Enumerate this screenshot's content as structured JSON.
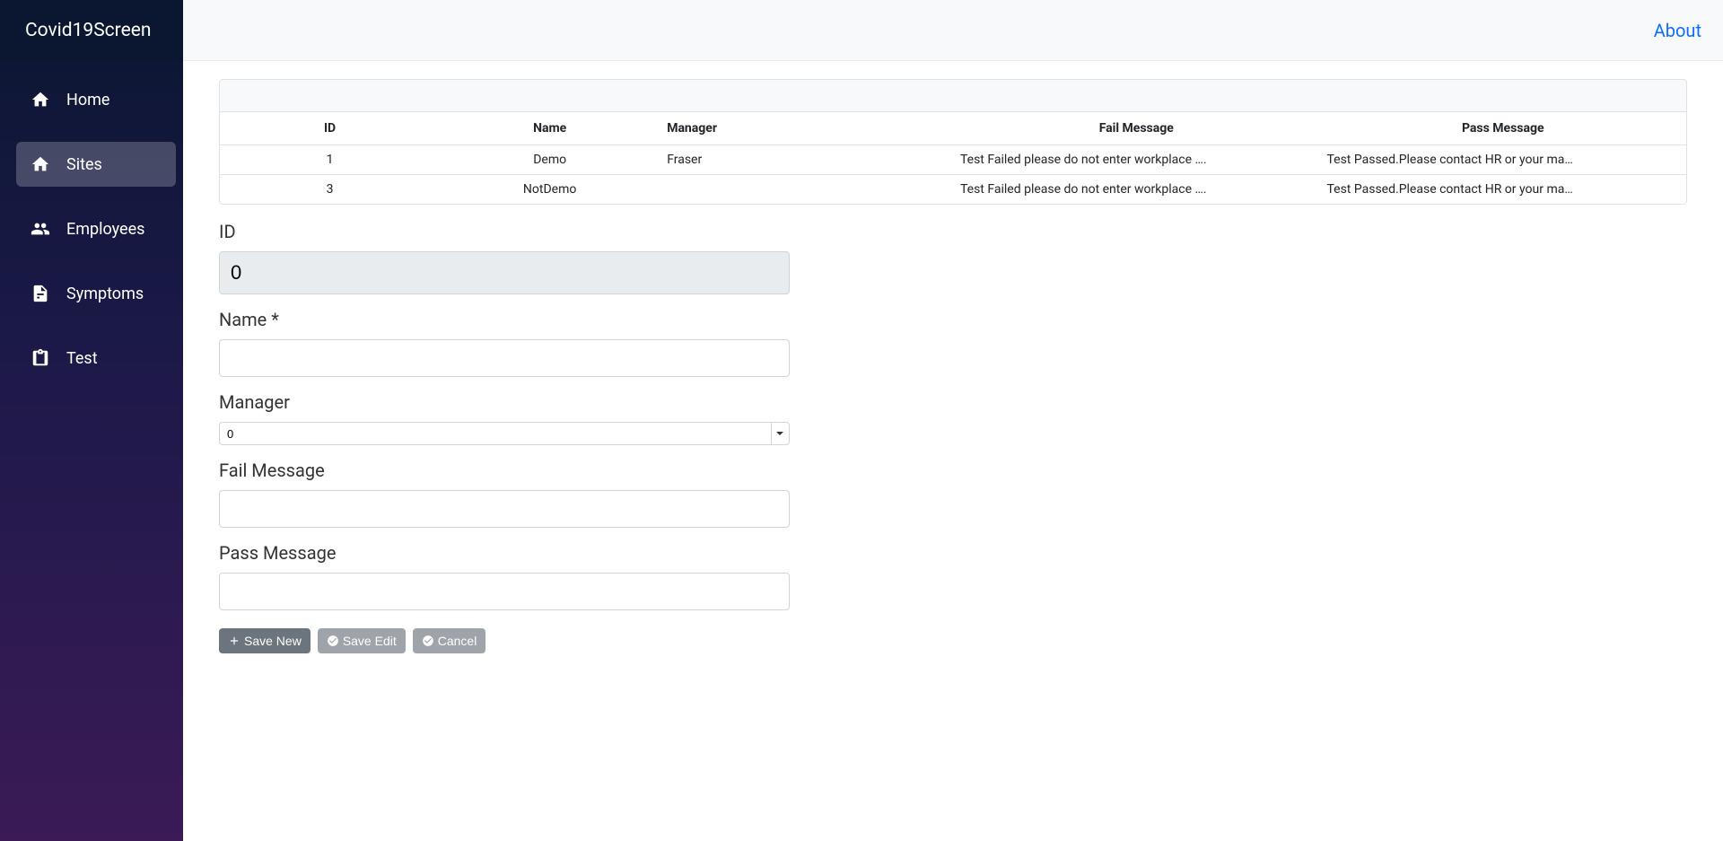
{
  "brand": "Covid19Screen",
  "topnav": {
    "about": "About"
  },
  "sidebar": {
    "items": [
      {
        "label": "Home",
        "icon": "home-icon",
        "active": false
      },
      {
        "label": "Sites",
        "icon": "home-icon",
        "active": true
      },
      {
        "label": "Employees",
        "icon": "people-icon",
        "active": false
      },
      {
        "label": "Symptoms",
        "icon": "file-icon",
        "active": false
      },
      {
        "label": "Test",
        "icon": "clipboard-icon",
        "active": false
      }
    ]
  },
  "table": {
    "headers": {
      "id": "ID",
      "name": "Name",
      "manager": "Manager",
      "failMessage": "Fail Message",
      "passMessage": "Pass Message"
    },
    "rows": [
      {
        "id": "1",
        "name": "Demo",
        "manager": "Fraser",
        "failMessage": "Test Failed please do not enter workplace ….",
        "passMessage": "Test Passed.Please contact HR or your ma…"
      },
      {
        "id": "3",
        "name": "NotDemo",
        "manager": "",
        "failMessage": "Test Failed please do not enter workplace ….",
        "passMessage": "Test Passed.Please contact HR or your ma…"
      }
    ]
  },
  "form": {
    "labels": {
      "id": "ID",
      "name": "Name *",
      "manager": "Manager",
      "failMessage": "Fail Message",
      "passMessage": "Pass Message"
    },
    "values": {
      "id": "0",
      "name": "",
      "manager": "0",
      "failMessage": "",
      "passMessage": ""
    }
  },
  "buttons": {
    "saveNew": "Save New",
    "saveEdit": "Save Edit",
    "cancel": "Cancel"
  }
}
